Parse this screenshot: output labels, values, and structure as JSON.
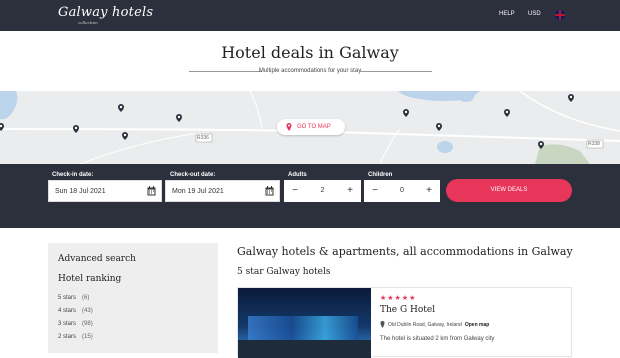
{
  "header": {
    "logo": "Galway hotels",
    "logo_sub": "collection",
    "help": "HELP",
    "currency": "USD"
  },
  "hero": {
    "title": "Hotel deals in Galway",
    "subtitle": "Multiple accommodations for your stay"
  },
  "map": {
    "goto_label": "GO TO MAP",
    "road_labels": [
      "R336",
      "R338"
    ]
  },
  "search": {
    "checkin_label": "Check-in date:",
    "checkin_value": "Sun 18 Jul 2021",
    "checkout_label": "Check-out date:",
    "checkout_value": "Mon 19 Jul 2021",
    "adults_label": "Adults",
    "adults_value": "2",
    "children_label": "Children",
    "children_value": "0",
    "minus": "−",
    "plus": "+",
    "submit_label": "VIEW DEALS"
  },
  "sidebar": {
    "title": "Advanced search",
    "ranking_title": "Hotel ranking",
    "ranks": [
      {
        "label": "5 stars",
        "count": "(6)"
      },
      {
        "label": "4 stars",
        "count": "(43)"
      },
      {
        "label": "3 stars",
        "count": "(98)"
      },
      {
        "label": "2 stars",
        "count": "(15)"
      }
    ]
  },
  "main": {
    "title": "Galway hotels & apartments, all accommodations in Galway",
    "section_title": "5 star Galway hotels",
    "hotel": {
      "stars": "★★★★★",
      "name": "The G Hotel",
      "address": "Old Dublin Road, Galway, Ireland",
      "open_map": "Open map",
      "description": "The hotel is situated 2 km from Galway city"
    }
  },
  "colors": {
    "nav_bg": "#2c2f3c",
    "accent": "#e8355a",
    "map_bg": "#ebeced"
  }
}
